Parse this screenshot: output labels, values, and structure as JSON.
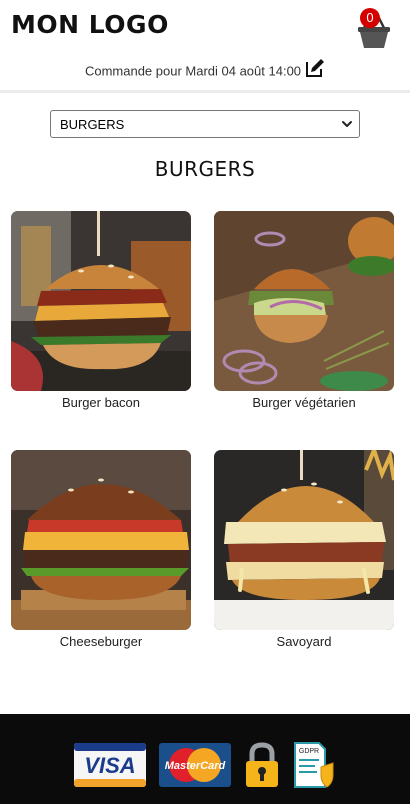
{
  "header": {
    "logo_text": "MON LOGO",
    "cart_count": "0",
    "order_text": "Commande pour Mardi 04 août 14:00"
  },
  "filter": {
    "selected": "BURGERS",
    "options": [
      "BURGERS"
    ]
  },
  "section": {
    "title": "BURGERS"
  },
  "products": [
    {
      "name": "Burger bacon"
    },
    {
      "name": "Burger végétarien"
    },
    {
      "name": "Cheeseburger"
    },
    {
      "name": "Savoyard"
    }
  ],
  "footer": {
    "visa_text": "VISA",
    "mastercard_text": "MasterCard",
    "gdpr_text": "GDPR"
  },
  "icons": {
    "cart": "basket-icon",
    "edit": "edit-pencil-icon",
    "dropdown": "chevron-down-icon",
    "security": "padlock-icon"
  },
  "colors": {
    "badge": "#d40000",
    "footer_bg": "#0b0b0b",
    "text": "#222222"
  }
}
